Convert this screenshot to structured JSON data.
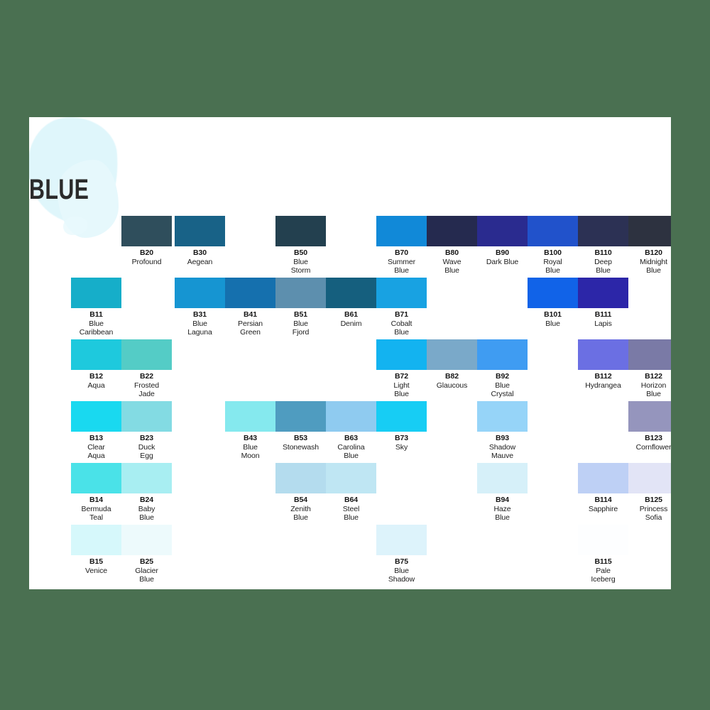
{
  "page": {
    "background_color": "#4a7051",
    "card_color": "#ffffff",
    "section_title": "BLUE",
    "brush_color": "#dff6fb"
  },
  "grid": {
    "columns": 12,
    "column_x": [
      0,
      71,
      146,
      217,
      288,
      359,
      430,
      501,
      572,
      643,
      714,
      785
    ],
    "rows": [
      {
        "row_label": "row-0",
        "cells": [
          {
            "col": 0,
            "empty": true
          },
          {
            "col": 1,
            "code": "B20",
            "name": "Profound",
            "color": "#2f4e5c"
          },
          {
            "col": 2,
            "code": "B30",
            "name": "Aegean",
            "color": "#186287"
          },
          {
            "col": 3,
            "empty": true
          },
          {
            "col": 4,
            "code": "B50",
            "name": "Blue\nStorm",
            "color": "#23404f"
          },
          {
            "col": 5,
            "empty": true
          },
          {
            "col": 6,
            "code": "B70",
            "name": "Summer\nBlue",
            "color": "#1189d8"
          },
          {
            "col": 7,
            "code": "B80",
            "name": "Wave\nBlue",
            "color": "#252a4f"
          },
          {
            "col": 8,
            "code": "B90",
            "name": "Dark Blue",
            "color": "#2a2b8f"
          },
          {
            "col": 9,
            "code": "B100",
            "name": "Royal\nBlue",
            "color": "#2152cb"
          },
          {
            "col": 10,
            "code": "B110",
            "name": "Deep\nBlue",
            "color": "#2c3154"
          },
          {
            "col": 11,
            "code": "B120",
            "name": "Midnight\nBlue",
            "color": "#2d3240"
          }
        ]
      },
      {
        "row_label": "row-1",
        "cells": [
          {
            "col": 0,
            "code": "B11",
            "name": "Blue\nCaribbean",
            "color": "#16aec9"
          },
          {
            "col": 1,
            "empty": true
          },
          {
            "col": 2,
            "code": "B31",
            "name": "Blue\nLaguna",
            "color": "#1695d2"
          },
          {
            "col": 3,
            "code": "B41",
            "name": "Persian\nGreen",
            "color": "#1570ae"
          },
          {
            "col": 4,
            "code": "B51",
            "name": "Blue\nFjord",
            "color": "#5d8fae"
          },
          {
            "col": 5,
            "code": "B61",
            "name": "Denim",
            "color": "#155f7e"
          },
          {
            "col": 6,
            "code": "B71",
            "name": "Cobalt\nBlue",
            "color": "#18a2e2"
          },
          {
            "col": 7,
            "empty": true
          },
          {
            "col": 8,
            "empty": true
          },
          {
            "col": 9,
            "code": "B101",
            "name": "Blue",
            "color": "#1163e8"
          },
          {
            "col": 10,
            "code": "B111",
            "name": "Lapis",
            "color": "#2c26a8"
          },
          {
            "col": 11,
            "empty": true
          }
        ]
      },
      {
        "row_label": "row-2",
        "cells": [
          {
            "col": 0,
            "code": "B12",
            "name": "Aqua",
            "color": "#1ec9dd"
          },
          {
            "col": 1,
            "code": "B22",
            "name": "Frosted\nJade",
            "color": "#54ccc6"
          },
          {
            "col": 2,
            "empty": true
          },
          {
            "col": 3,
            "empty": true
          },
          {
            "col": 4,
            "empty": true
          },
          {
            "col": 5,
            "empty": true
          },
          {
            "col": 6,
            "code": "B72",
            "name": "Light\nBlue",
            "color": "#13b3f0"
          },
          {
            "col": 7,
            "code": "B82",
            "name": "Glaucous",
            "color": "#7aa9c9"
          },
          {
            "col": 8,
            "code": "B92",
            "name": "Blue\nCrystal",
            "color": "#3f9cf2"
          },
          {
            "col": 9,
            "empty": true
          },
          {
            "col": 10,
            "code": "B112",
            "name": "Hydrangea",
            "color": "#6b6fe3"
          },
          {
            "col": 11,
            "code": "B122",
            "name": "Horizon\nBlue",
            "color": "#7a7aa6"
          }
        ]
      },
      {
        "row_label": "row-3",
        "cells": [
          {
            "col": 0,
            "code": "B13",
            "name": "Clear\nAqua",
            "color": "#19d9f0"
          },
          {
            "col": 1,
            "code": "B23",
            "name": "Duck\nEgg",
            "color": "#83dbe3"
          },
          {
            "col": 2,
            "empty": true
          },
          {
            "col": 3,
            "code": "B43",
            "name": "Blue\nMoon",
            "color": "#85e9ee"
          },
          {
            "col": 4,
            "code": "B53",
            "name": "Stonewash",
            "color": "#4f9cc0"
          },
          {
            "col": 5,
            "code": "B63",
            "name": "Carolina\nBlue",
            "color": "#8fcbf0"
          },
          {
            "col": 6,
            "code": "B73",
            "name": "Sky",
            "color": "#17cdf4"
          },
          {
            "col": 7,
            "empty": true
          },
          {
            "col": 8,
            "code": "B93",
            "name": "Shadow\nMauve",
            "color": "#96d4f8"
          },
          {
            "col": 9,
            "empty": true
          },
          {
            "col": 10,
            "empty": true
          },
          {
            "col": 11,
            "code": "B123",
            "name": "Cornflower",
            "color": "#9595bd"
          }
        ]
      },
      {
        "row_label": "row-4",
        "cells": [
          {
            "col": 0,
            "code": "B14",
            "name": "Bermuda\nTeal",
            "color": "#4ae2e8"
          },
          {
            "col": 1,
            "code": "B24",
            "name": "Baby\nBlue",
            "color": "#a8eef2"
          },
          {
            "col": 2,
            "empty": true
          },
          {
            "col": 3,
            "empty": true
          },
          {
            "col": 4,
            "code": "B54",
            "name": "Zenith\nBlue",
            "color": "#b4dcee"
          },
          {
            "col": 5,
            "code": "B64",
            "name": "Steel\nBlue",
            "color": "#bfe6f3"
          },
          {
            "col": 6,
            "empty": true
          },
          {
            "col": 7,
            "empty": true
          },
          {
            "col": 8,
            "code": "B94",
            "name": "Haze\nBlue",
            "color": "#d6f0f9"
          },
          {
            "col": 9,
            "empty": true
          },
          {
            "col": 10,
            "code": "B114",
            "name": "Sapphire",
            "color": "#bed0f5"
          },
          {
            "col": 11,
            "code": "B125",
            "name": "Princess\nSofia",
            "color": "#e2e4f6"
          }
        ]
      },
      {
        "row_label": "row-5",
        "cells": [
          {
            "col": 0,
            "code": "B15",
            "name": "Venice",
            "color": "#d6f8fb"
          },
          {
            "col": 1,
            "code": "B25",
            "name": "Glacier\nBlue",
            "color": "#edfafc"
          },
          {
            "col": 2,
            "empty": true
          },
          {
            "col": 3,
            "empty": true
          },
          {
            "col": 4,
            "empty": true
          },
          {
            "col": 5,
            "empty": true
          },
          {
            "col": 6,
            "code": "B75",
            "name": "Blue\nShadow",
            "color": "#ddf3fb"
          },
          {
            "col": 7,
            "empty": true
          },
          {
            "col": 8,
            "empty": true
          },
          {
            "col": 9,
            "empty": true
          },
          {
            "col": 10,
            "code": "B115",
            "name": "Pale\nIceberg",
            "color": "#fdfeff"
          },
          {
            "col": 11,
            "empty": true
          }
        ]
      }
    ]
  }
}
